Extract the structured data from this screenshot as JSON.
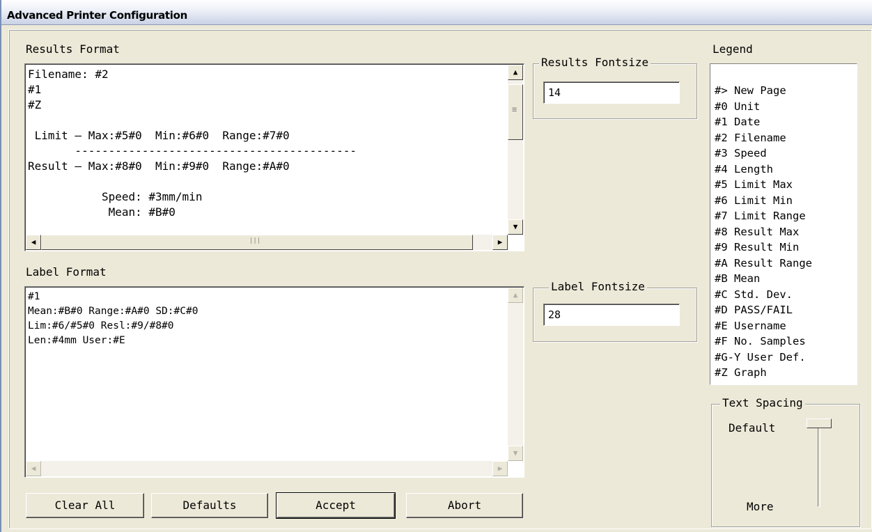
{
  "window": {
    "title": "Advanced Printer Configuration"
  },
  "results_format": {
    "label": "Results Format",
    "lines": [
      "Filename: #2",
      "#1",
      "#Z",
      "",
      " Limit – Max:#5#0  Min:#6#0  Range:#7#0",
      "       ------------------------------------------",
      "Result – Max:#8#0  Min:#9#0  Range:#A#0",
      "",
      "           Speed: #3mm/min",
      "            Mean: #B#0"
    ]
  },
  "label_format": {
    "label": "Label Format",
    "lines": [
      "#1",
      "Mean:#B#0 Range:#A#0 SD:#C#0",
      "Lim:#6/#5#0 Resl:#9/#8#0",
      "Len:#4mm User:#E"
    ]
  },
  "results_fontsize": {
    "label": "Results Fontsize",
    "value": "14"
  },
  "label_fontsize": {
    "label": "Label Fontsize",
    "value": "28"
  },
  "legend": {
    "label": "Legend",
    "items": [
      "#> New Page",
      "#0 Unit",
      "#1 Date",
      "#2 Filename",
      "#3 Speed",
      "#4 Length",
      "#5 Limit Max",
      "#6 Limit Min",
      "#7 Limit Range",
      "#8 Result Max",
      "#9 Result Min",
      "#A Result Range",
      "#B Mean",
      "#C Std. Dev.",
      "#D PASS/FAIL",
      "#E Username",
      "#F No. Samples",
      "#G-Y User Def.",
      "#Z Graph"
    ]
  },
  "text_spacing": {
    "label": "Text Spacing",
    "top_label": "Default",
    "bottom_label": "More"
  },
  "buttons": {
    "clear_all": "Clear All",
    "defaults": "Defaults",
    "accept": "Accept",
    "abort": "Abort"
  },
  "icons": {
    "scroll_up": "▲",
    "scroll_down": "▼",
    "scroll_left": "◀",
    "scroll_right": "▶",
    "grip": "≡",
    "grip_h": "|||"
  }
}
